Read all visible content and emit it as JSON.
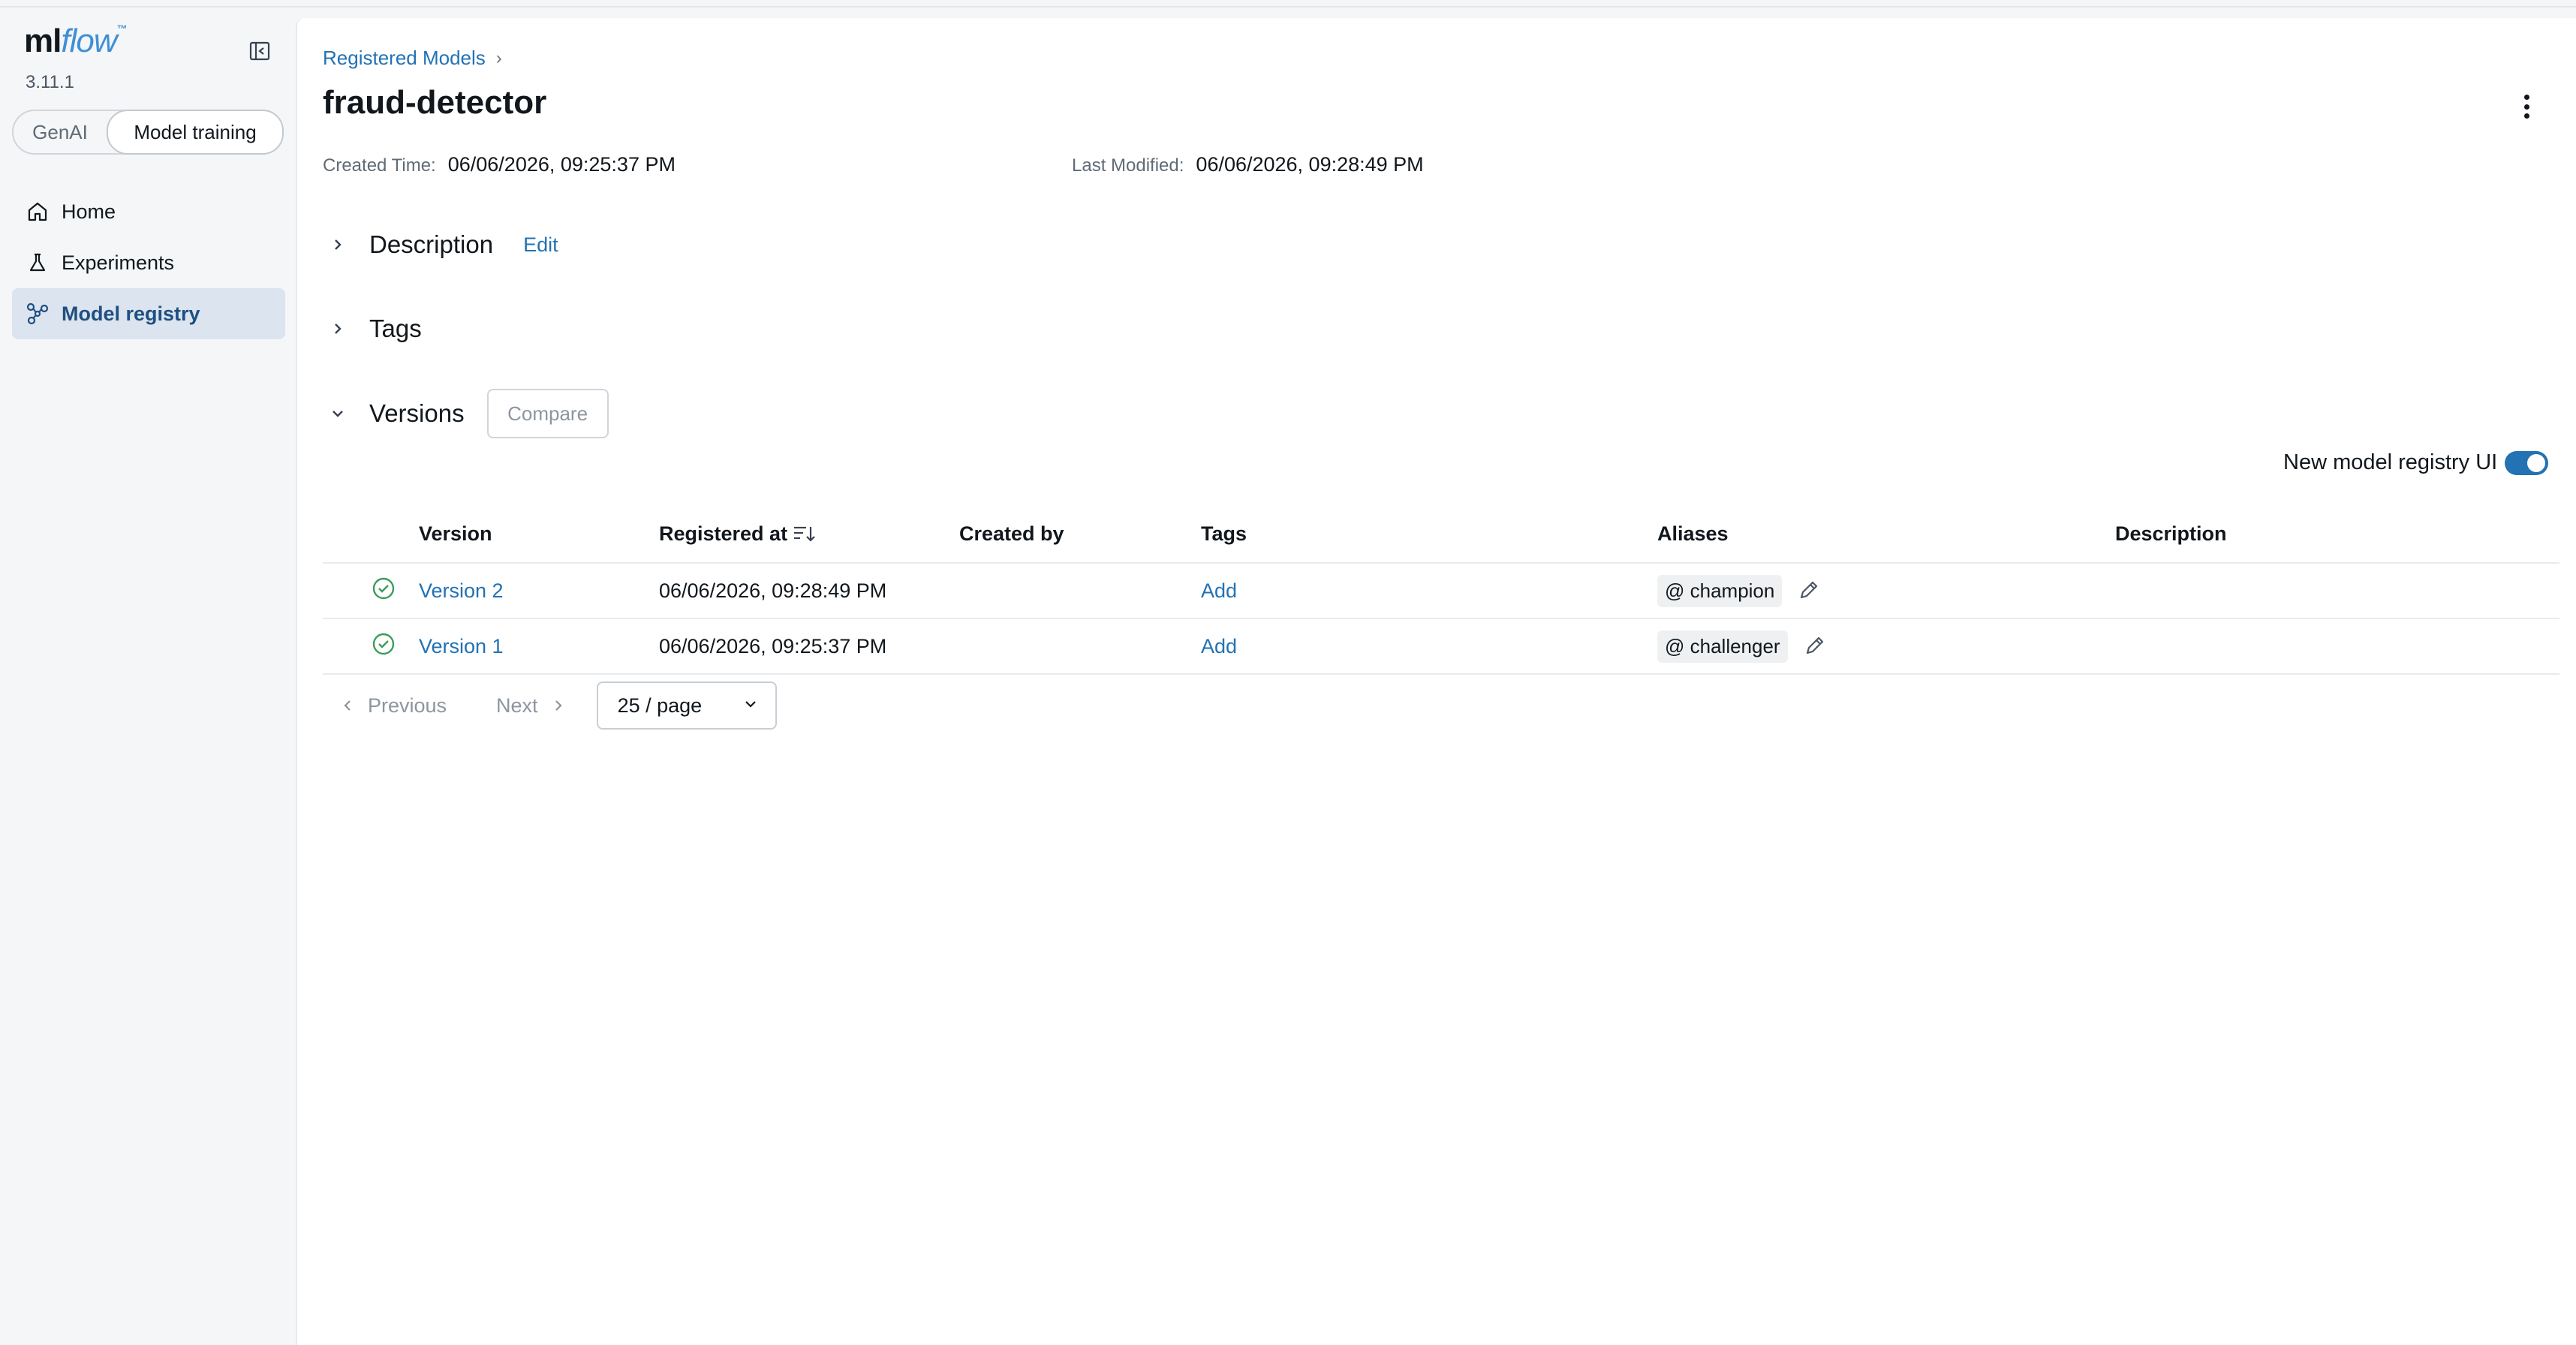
{
  "app": {
    "logo_ml": "ml",
    "logo_flow": "flow",
    "version": "3.11.1"
  },
  "sidebar": {
    "modes": [
      {
        "label": "GenAI",
        "active": false
      },
      {
        "label": "Model training",
        "active": true
      }
    ],
    "items": [
      {
        "label": "Home",
        "icon": "home-icon",
        "active": false
      },
      {
        "label": "Experiments",
        "icon": "beaker-icon",
        "active": false
      },
      {
        "label": "Model registry",
        "icon": "model-graph-icon",
        "active": true
      }
    ]
  },
  "header": {
    "breadcrumb": "Registered Models",
    "breadcrumb_sep": "›",
    "title": "fraud-detector",
    "created_label": "Created Time:",
    "created_value": "06/06/2026, 09:25:37 PM",
    "modified_label": "Last Modified:",
    "modified_value": "06/06/2026, 09:28:49 PM"
  },
  "sections": {
    "description": "Description",
    "edit": "Edit",
    "tags": "Tags",
    "versions": "Versions",
    "compare": "Compare"
  },
  "toggle": {
    "label": "New model registry UI",
    "on": true
  },
  "table": {
    "columns": [
      "Version",
      "Registered at",
      "Created by",
      "Tags",
      "Aliases",
      "Description"
    ],
    "rows": [
      {
        "version": "Version 2",
        "registered_at": "06/06/2026, 09:28:49 PM",
        "created_by": "",
        "tags": "Add",
        "alias": "@ champion",
        "description": ""
      },
      {
        "version": "Version 1",
        "registered_at": "06/06/2026, 09:25:37 PM",
        "created_by": "",
        "tags": "Add",
        "alias": "@ challenger",
        "description": ""
      }
    ]
  },
  "pagination": {
    "previous": "Previous",
    "next": "Next",
    "page_size": "25 / page"
  },
  "colors": {
    "accent": "#2272b4",
    "success": "#3a9c5a",
    "sidebar_active_bg": "#dbe4ef"
  }
}
